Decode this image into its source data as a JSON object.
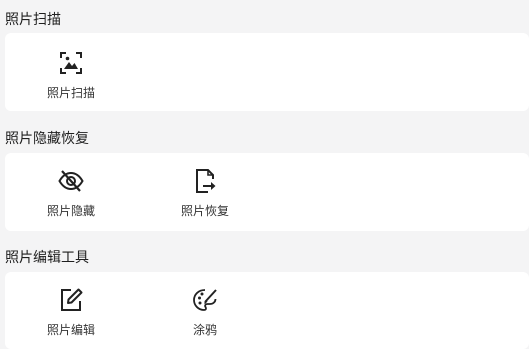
{
  "sections": [
    {
      "title": "照片扫描",
      "items": [
        {
          "label": "照片扫描",
          "icon": "scan-photo-icon"
        }
      ]
    },
    {
      "title": "照片隐藏恢复",
      "items": [
        {
          "label": "照片隐藏",
          "icon": "eye-off-icon"
        },
        {
          "label": "照片恢复",
          "icon": "file-restore-icon"
        }
      ]
    },
    {
      "title": "照片编辑工具",
      "items": [
        {
          "label": "照片编辑",
          "icon": "edit-pen-icon"
        },
        {
          "label": "涂鸦",
          "icon": "palette-brush-icon"
        }
      ]
    }
  ]
}
